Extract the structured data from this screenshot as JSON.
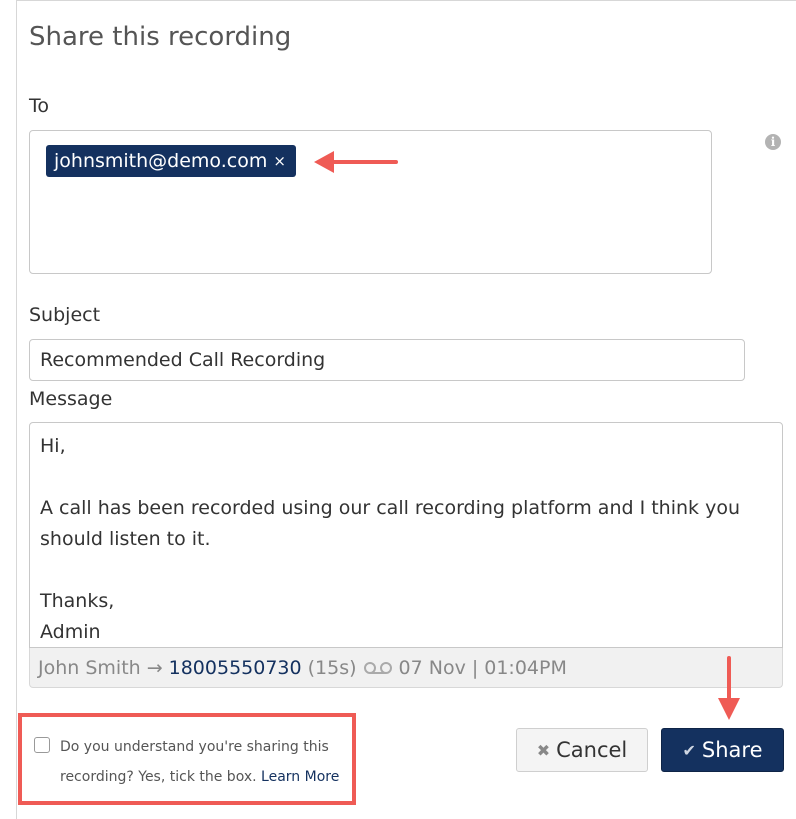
{
  "dialog": {
    "title": "Share this recording"
  },
  "to": {
    "label": "To",
    "recipients": [
      {
        "email": "johnsmith@demo.com",
        "remove": "×"
      }
    ],
    "info_icon": "info-icon"
  },
  "subject": {
    "label": "Subject",
    "value": "Recommended Call Recording"
  },
  "message": {
    "label": "Message",
    "body": "Hi,\n\nA call has been recorded using our call recording platform and I think you should listen to it.\n\nThanks,\nAdmin"
  },
  "recording": {
    "caller": "John Smith",
    "arrow": "→",
    "number": "18005550730",
    "duration": "(15s)",
    "voicemail_icon": "voicemail-icon",
    "date": "07 Nov",
    "separator": "|",
    "time": "01:04PM"
  },
  "confirm": {
    "text": "Do you understand you're sharing this recording? Yes, tick the box.",
    "link": "Learn More",
    "checked": false
  },
  "actions": {
    "cancel": {
      "icon": "close-icon",
      "glyph": "✖",
      "label": "Cancel"
    },
    "share": {
      "icon": "check-icon",
      "glyph": "✔",
      "label": "Share"
    }
  },
  "colors": {
    "accent": "#14315f",
    "highlight": "#ef5b55"
  }
}
